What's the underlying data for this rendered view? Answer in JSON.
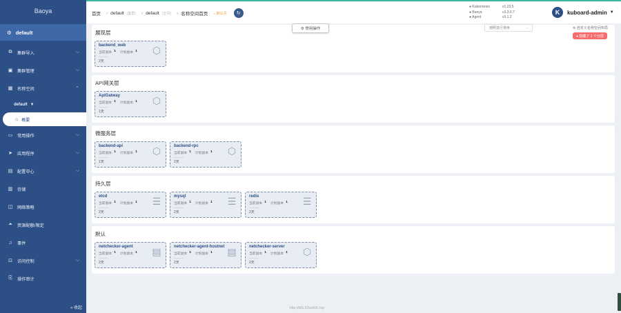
{
  "sidebar": {
    "brand": "Baoya",
    "namespace": "default",
    "items": [
      {
        "label": "集群导入",
        "icon": "import-icon"
      },
      {
        "label": "集群管理",
        "icon": "cluster-icon"
      },
      {
        "label": "名称空间",
        "icon": "grid-icon"
      }
    ],
    "ns_selector": "default",
    "active_item": "概要",
    "sub_items": [
      {
        "label": "常用操作",
        "icon": "folder-icon"
      },
      {
        "label": "应用程序",
        "icon": "send-icon"
      },
      {
        "label": "配置中心",
        "icon": "config-icon"
      },
      {
        "label": "存储",
        "icon": "storage-icon"
      },
      {
        "label": "网络策略",
        "icon": "network-icon"
      },
      {
        "label": "资源配额/限定",
        "icon": "quota-icon"
      },
      {
        "label": "事件",
        "icon": "bell-icon"
      }
    ],
    "bottom_items": [
      {
        "label": "访问控制",
        "icon": "lock-icon"
      },
      {
        "label": "操作审计",
        "icon": "audit-icon"
      }
    ],
    "collapse_label": "« 收起"
  },
  "header": {
    "crumbs": [
      {
        "label": "首页"
      },
      {
        "label": "default",
        "tag": "(集群)"
      },
      {
        "label": "default",
        "tag": "(空间)"
      },
      {
        "label": "名称空间首页"
      }
    ],
    "home_tag": "⌂ 默认页",
    "versions": [
      {
        "k": "● Kubernetes",
        "v": "v1.23.5"
      },
      {
        "k": "● Baoya",
        "v": "v3.3.0.7"
      },
      {
        "k": "● Agent",
        "v": "v3.1.2"
      }
    ],
    "user": "kuboard-admin",
    "user_initial": "K"
  },
  "toolbar": {
    "common_ops": "⚙ 常用操作",
    "sort_placeholder": "按照进行排序",
    "custom_layout": "⚙ 自定义名称空间布局",
    "hidden_badge": "● 隐藏了 2 个分层"
  },
  "layers": [
    {
      "title": "展现层",
      "cards": [
        {
          "name": "backend_web",
          "current": "1",
          "planned": "1",
          "age": "2天",
          "icon": "cube-icon"
        }
      ]
    },
    {
      "title": "API网关层",
      "cards": [
        {
          "name": "ApiGatway",
          "current": "1",
          "planned": "1",
          "age": "1天",
          "icon": "cube-icon"
        }
      ]
    },
    {
      "title": "微服务层",
      "cards": [
        {
          "name": "backend-api",
          "current": "1",
          "planned": "1",
          "age": "1天",
          "icon": "cube-icon"
        },
        {
          "name": "backend-rpc",
          "current": "1",
          "planned": "1",
          "age": "2天",
          "icon": "cube-icon"
        }
      ]
    },
    {
      "title": "持久层",
      "cards": [
        {
          "name": "etcd",
          "current": "1",
          "planned": "1",
          "age": "2天",
          "icon": "server-icon"
        },
        {
          "name": "mysql",
          "current": "1",
          "planned": "1",
          "age": "2天",
          "icon": "server-icon"
        },
        {
          "name": "redis",
          "current": "1",
          "planned": "1",
          "age": "2天",
          "icon": "server-icon"
        }
      ]
    },
    {
      "title": "默认",
      "cards": [
        {
          "name": "netchecker-agent",
          "current": "1",
          "planned": "1",
          "age": "2天",
          "icon": "daemonset-icon"
        },
        {
          "name": "netchecker-agent-hostnet",
          "current": "1",
          "planned": "1",
          "age": "2天",
          "icon": "daemonset-icon"
        },
        {
          "name": "netchecker-server",
          "current": "1",
          "planned": "1",
          "age": "2天",
          "icon": "cube-icon"
        }
      ]
    }
  ],
  "labels": {
    "current": "当前副本",
    "planned": "计划副本"
  },
  "footer_url": "http://k8s.52web/tc.top"
}
